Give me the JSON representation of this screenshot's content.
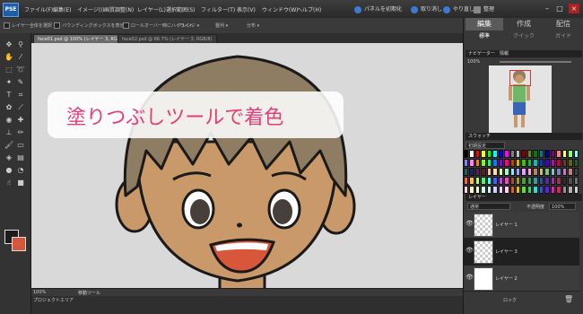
{
  "app": {
    "logo": "PSE"
  },
  "menu": [
    "ファイル(F)",
    "編集(E)",
    "イメージ(I)",
    "画質調整(N)",
    "レイヤー(L)",
    "選択範囲(S)",
    "フィルター(T)",
    "表示(V)",
    "ウィンドウ(W)",
    "ヘルプ(H)"
  ],
  "top_buttons": {
    "panel_reset": "パネルを初期化",
    "undo": "取り消し",
    "redo": "やり直し",
    "organizer": "整理"
  },
  "options_bar": {
    "option1": "レイヤー全体を選択",
    "option2": "バウンディングボックスを表示",
    "option3": "ロールオーバー時にハイライト",
    "arrange": "アレンジ",
    "align": "整列",
    "distribute": "分布"
  },
  "doc_tabs": [
    {
      "label": "face01.psd @ 100% (レイヤー 3, RGB/8)",
      "active": true
    },
    {
      "label": "face02.psd @ 66.7% (レイヤー 3, RGB/8)",
      "active": false
    }
  ],
  "caption": "塗りつぶしツールで着色",
  "status": {
    "zoom": "100%",
    "tool": "移動ツール"
  },
  "project_bin": "プロジェクトエリア",
  "panel": {
    "tabs": [
      "編集",
      "作成",
      "配信"
    ],
    "subtabs": [
      "標準",
      "クイック",
      "ガイド"
    ],
    "navigator": {
      "title": "ナビゲーター",
      "tab2": "情報",
      "zoom": "100%"
    },
    "swatches": {
      "title": "スウォッチ",
      "preset": "初期設定"
    },
    "layers": {
      "title": "レイヤー",
      "blend_mode": "通常",
      "opacity_label": "不透明度",
      "opacity": "100%",
      "lock_label": "ロック",
      "items": [
        {
          "name": "レイヤー 1"
        },
        {
          "name": "レイヤー 3"
        },
        {
          "name": "レイヤー 2"
        }
      ]
    }
  },
  "colors": {
    "caption_text": "#e53c7a",
    "foreground": "#1b1b1b",
    "background": "#d8563a",
    "skin": "#c9996a",
    "hair": "#8f7d63",
    "mouth": "#d8563a",
    "accent": "#1d5fa8"
  },
  "swatch_colors": [
    "#000000",
    "#ffffff",
    "#ff0000",
    "#ffff00",
    "#00ff00",
    "#00ffff",
    "#0000ff",
    "#ff00ff",
    "#808080",
    "#c0c0c0",
    "#800000",
    "#808000",
    "#008000",
    "#008080",
    "#000080",
    "#800080",
    "#ff8080",
    "#ffff80",
    "#80ff80",
    "#80ffff",
    "#8080ff",
    "#ff80ff",
    "#ff8000",
    "#80ff00",
    "#00ff80",
    "#0080ff",
    "#8000ff",
    "#ff0080",
    "#c04000",
    "#c0c000",
    "#40c000",
    "#00c040",
    "#00c0c0",
    "#0040c0",
    "#4000c0",
    "#c000c0",
    "#c00040",
    "#604020",
    "#606020",
    "#206020",
    "#206060",
    "#202060",
    "#602060",
    "#602020",
    "#ffc0a0",
    "#ffe0a0",
    "#e0ffa0",
    "#a0ffc0",
    "#a0e0ff",
    "#a0a0ff",
    "#e0a0ff",
    "#ffa0e0",
    "#c08060",
    "#c0c080",
    "#80c080",
    "#80c0c0",
    "#8080c0",
    "#c080c0",
    "#c08080",
    "#404040",
    "#ff6040",
    "#ffc040",
    "#c0ff40",
    "#40ff60",
    "#40ffff",
    "#4060ff",
    "#c040ff",
    "#ff40c0",
    "#a05030",
    "#a0a030",
    "#50a030",
    "#30a050",
    "#30a0a0",
    "#3050a0",
    "#5030a0",
    "#a030a0",
    "#a03050",
    "#303030",
    "#505050",
    "#707070",
    "#ffd0d0",
    "#fff0d0",
    "#f0ffd0",
    "#d0ffe0",
    "#d0f0ff",
    "#d0d0ff",
    "#f0d0ff",
    "#ffd0f0",
    "#e06020",
    "#e0c020",
    "#60e020",
    "#20e060",
    "#20e0e0",
    "#2060e0",
    "#6020e0",
    "#e020c0",
    "#e02060",
    "#909090",
    "#b0b0b0",
    "#d0d0d0"
  ]
}
